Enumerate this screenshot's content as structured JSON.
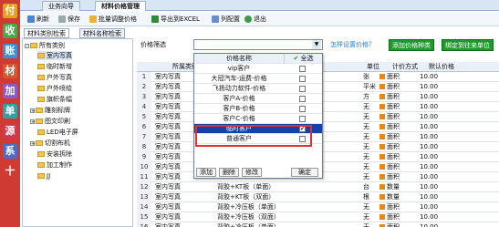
{
  "sidebar": {
    "items": [
      "付",
      "收",
      "账",
      "材",
      "加",
      "单",
      "源",
      "系",
      "十"
    ]
  },
  "tabs": [
    {
      "label": "业务向导"
    },
    {
      "label": "材料价格管理"
    }
  ],
  "toolbar": {
    "refresh": "刷新",
    "save": "保存",
    "batch": "批量调整价格",
    "export": "导出到EXCEL",
    "columns": "列配置",
    "exit": "退出"
  },
  "left_tabs": [
    "材料类别检索",
    "材料名称检索"
  ],
  "tree": {
    "root": "所有类别",
    "children": [
      "室内写真",
      "临时新增",
      "户外写真",
      "户外喷绘",
      "旗帜条幅",
      "雕刻标牌",
      "图文印刷",
      "LED电子屏",
      "切割布机",
      "安装拆除",
      "加工制作",
      "JJ"
    ]
  },
  "filter": {
    "label": "价格筛选",
    "help_link": "怎样设置价格？",
    "add_button": "添加价格种类",
    "bind_button": "绑定到往来单位"
  },
  "grid": {
    "headers": [
      "",
      "所属类别",
      "",
      "单位",
      "计价方式",
      "默认价格"
    ],
    "rows": [
      {
        "n": "1",
        "cat": "室内写真",
        "name": "",
        "unit": "张",
        "mode": "面积",
        "price": "10.00"
      },
      {
        "n": "2",
        "cat": "室内写真",
        "name": "",
        "unit": "平米",
        "mode": "面积",
        "price": "10.00"
      },
      {
        "n": "3",
        "cat": "室内写真",
        "name": "",
        "unit": "方",
        "mode": "面积",
        "price": "10.00"
      },
      {
        "n": "4",
        "cat": "室内写真",
        "name": "",
        "unit": "无",
        "mode": "面积",
        "price": "10.00"
      },
      {
        "n": "5",
        "cat": "室内写真",
        "name": "",
        "unit": "无",
        "mode": "面积",
        "price": "10.00"
      },
      {
        "n": "6",
        "cat": "室内写真",
        "name": "",
        "unit": "无",
        "mode": "面积",
        "price": "10.00"
      },
      {
        "n": "7",
        "cat": "室内写真",
        "name": "",
        "unit": "无",
        "mode": "面积",
        "price": "10.00"
      },
      {
        "n": "8",
        "cat": "室内写真",
        "name": "",
        "unit": "无",
        "mode": "面积",
        "price": "10.00"
      },
      {
        "n": "9",
        "cat": "室内写真",
        "name": "",
        "unit": "无",
        "mode": "面积",
        "price": "10.00"
      },
      {
        "n": "10",
        "cat": "室内写真",
        "name": "",
        "unit": "无",
        "mode": "面积",
        "price": "10.00"
      },
      {
        "n": "11",
        "cat": "室内写真",
        "name": "",
        "unit": "无",
        "mode": "面积",
        "price": "10.00"
      },
      {
        "n": "12",
        "cat": "室内写真",
        "name": "背胶+KT板（单面）",
        "unit": "台",
        "mode": "数量",
        "price": "10.00"
      },
      {
        "n": "13",
        "cat": "室内写真",
        "name": "背胶+KT板（双面）",
        "unit": "根",
        "mode": "数量",
        "price": "10.00"
      },
      {
        "n": "14",
        "cat": "室内写真",
        "name": "背胶+冷压板（单面）",
        "unit": "无",
        "mode": "面积",
        "price": "10.00"
      },
      {
        "n": "15",
        "cat": "室内写真",
        "name": "背胶+冷压板（双面）",
        "unit": "无",
        "mode": "面积",
        "price": "10.00"
      },
      {
        "n": "16",
        "cat": "室内写真",
        "name": "背胶+冷压板（单面）",
        "unit": "无",
        "mode": "面积",
        "price": "10.00"
      }
    ]
  },
  "dropdown": {
    "col_name": "价格名称",
    "col_all": "全选",
    "items": [
      {
        "label": "vip客户",
        "checked": false
      },
      {
        "label": "大冠汽车-运费-价格",
        "checked": false
      },
      {
        "label": "飞扬动力软件-价格",
        "checked": false
      },
      {
        "label": "客户A-价格",
        "checked": false
      },
      {
        "label": "客户B-价格",
        "checked": false
      },
      {
        "label": "客户C-价格",
        "checked": false
      },
      {
        "label": "临时客户",
        "checked": true
      },
      {
        "label": "普通客户",
        "checked": false
      }
    ],
    "add": "添加",
    "delete": "删除",
    "edit": "修改",
    "ok": "确定"
  },
  "colors": {
    "accent": "#cf3b32",
    "green": "#1e9a2d",
    "highlight": "#1542a8",
    "mark": "#e08a1e",
    "redbox": "#e23030"
  }
}
